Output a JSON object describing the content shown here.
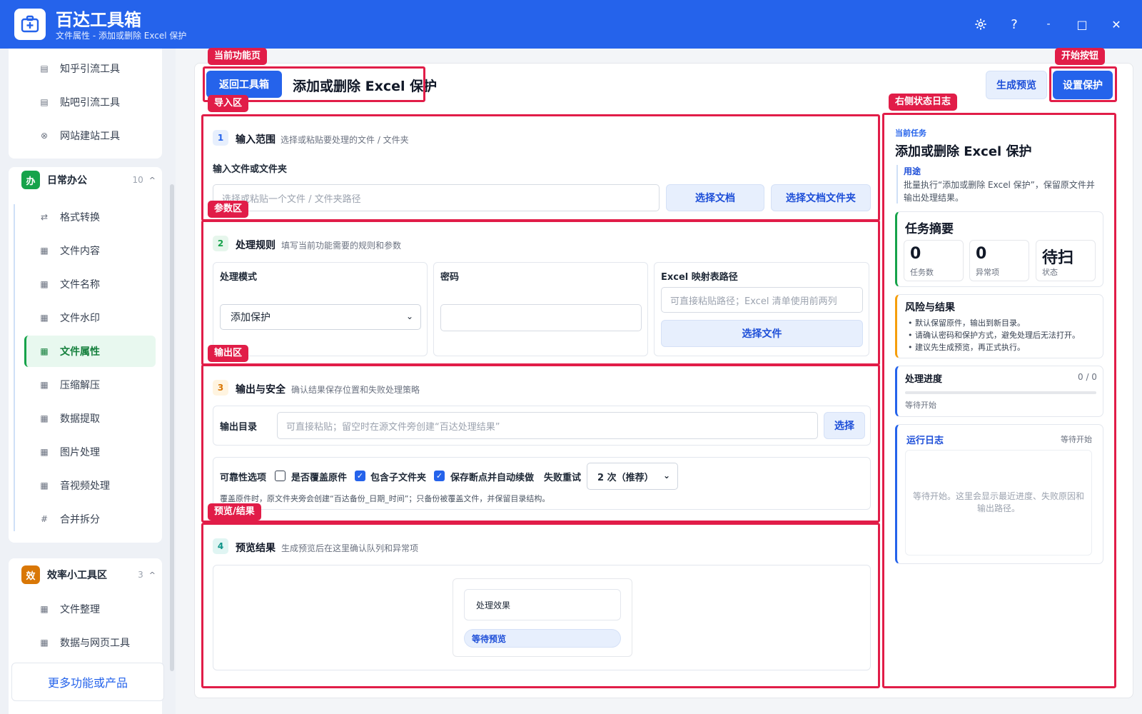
{
  "titlebar": {
    "app_name": "百达工具箱",
    "subtitle": "文件属性 - 添加或删除 Excel 保护",
    "settings_icon": "gear-icon",
    "help_label": "?",
    "minimize_label": "-",
    "maximize_label": "□",
    "close_label": "✕"
  },
  "sidebar": {
    "top_items": [
      {
        "label": "知乎引流工具",
        "icon": "document-icon"
      },
      {
        "label": "贴吧引流工具",
        "icon": "document-icon"
      },
      {
        "label": "网站建站工具",
        "icon": "globe-icon"
      }
    ],
    "group_office": {
      "badge": "办",
      "name": "日常办公",
      "count": "10",
      "chevron": "^",
      "color": "#16a34a"
    },
    "office_items": [
      {
        "label": "格式转换",
        "icon": "⇄"
      },
      {
        "label": "文件内容",
        "icon": "grid"
      },
      {
        "label": "文件名称",
        "icon": "grid"
      },
      {
        "label": "文件水印",
        "icon": "grid"
      },
      {
        "label": "文件属性",
        "icon": "grid",
        "active": true
      },
      {
        "label": "压缩解压",
        "icon": "grid"
      },
      {
        "label": "数据提取",
        "icon": "grid"
      },
      {
        "label": "图片处理",
        "icon": "grid"
      },
      {
        "label": "音视频处理",
        "icon": "grid"
      },
      {
        "label": "合并拆分",
        "icon": "#"
      }
    ],
    "group_tools": {
      "badge": "效",
      "name": "效率小工具区",
      "count": "3",
      "chevron": "^",
      "color": "#d97706"
    },
    "tools_items": [
      {
        "label": "文件整理",
        "icon": "grid"
      },
      {
        "label": "数据与网页工具",
        "icon": "grid"
      }
    ],
    "more_button": "更多功能或产品"
  },
  "header": {
    "back_button": "返回工具箱",
    "title": "添加或删除 Excel 保护",
    "preview_button": "生成预览",
    "start_button": "设置保护"
  },
  "annotations": {
    "current_page": "当前功能页",
    "start_button": "开始按钮",
    "import_area": "导入区",
    "status_log": "右侧状态日志",
    "param_area": "参数区",
    "output_area": "输出区",
    "preview_area": "预览/结果"
  },
  "section1": {
    "num": "1",
    "title": "输入范围",
    "subtitle": "选择或粘贴要处理的文件 / 文件夹",
    "field_label": "输入文件或文件夹",
    "placeholder": "选择或粘贴一个文件 / 文件夹路径",
    "select_doc": "选择文档",
    "select_folder": "选择文档文件夹"
  },
  "section2": {
    "num": "2",
    "title": "处理规则",
    "subtitle": "填写当前功能需要的规则和参数",
    "mode_label": "处理模式",
    "mode_value": "添加保护",
    "password_label": "密码",
    "password_value": "",
    "mapping_label": "Excel 映射表路径",
    "mapping_placeholder": "可直接粘贴路径；Excel 清单使用前两列",
    "select_file": "选择文件"
  },
  "section3": {
    "num": "3",
    "title": "输出与安全",
    "subtitle": "确认结果保存位置和失败处理策略",
    "output_label": "输出目录",
    "output_placeholder": "可直接粘贴；留空时在源文件旁创建“百达处理结果”",
    "select_button": "选择",
    "reliability_label": "可靠性选项",
    "overwrite_label": "是否覆盖原件",
    "overwrite_checked": false,
    "subfolder_label": "包含子文件夹",
    "subfolder_checked": true,
    "resume_label": "保存断点并自动续做",
    "resume_checked": true,
    "retry_label": "失败重试",
    "retry_value": "2 次（推荐）",
    "note": "覆盖原件时，原文件夹旁会创建“百达备份_日期_时间”；只备份被覆盖文件，并保留目录结构。"
  },
  "section4": {
    "num": "4",
    "title": "预览结果",
    "subtitle": "生成预览后在这里确认队列和异常项",
    "effect_label": "处理效果",
    "status_pill": "等待预览"
  },
  "right_panel": {
    "current_task_label": "当前任务",
    "task_title": "添加或删除 Excel 保护",
    "purpose_label": "用途",
    "purpose_text": "批量执行“添加或删除 Excel 保护”，保留原文件并输出处理结果。",
    "summary_title": "任务摘要",
    "stats": [
      {
        "value": "0",
        "label": "任务数"
      },
      {
        "value": "0",
        "label": "异常项"
      },
      {
        "value": "待扫",
        "label": "状态"
      }
    ],
    "risk_title": "风险与结果",
    "risk_items": [
      "默认保留原件，输出到新目录。",
      "请确认密码和保护方式，避免处理后无法打开。",
      "建议先生成预览，再正式执行。"
    ],
    "progress_title": "处理进度",
    "progress_count": "0 / 0",
    "progress_fraction": 0,
    "progress_status": "等待开始",
    "log_title": "运行日志",
    "log_status": "等待开始",
    "log_placeholder": "等待开始。这里会显示最近进度、失败原因和输出路径。"
  },
  "colors": {
    "brand": "#2563eb",
    "annotation": "#e11d48",
    "active_green": "#16a34a",
    "warn_orange": "#f59e0b"
  }
}
